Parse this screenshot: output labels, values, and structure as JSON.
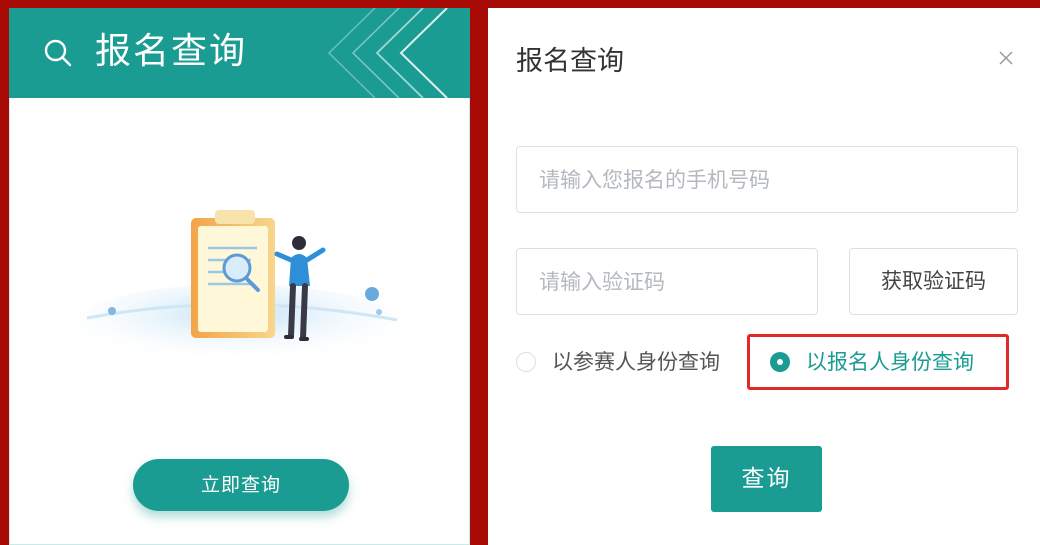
{
  "left_card": {
    "title": "报名查询",
    "button_label": "立即查询"
  },
  "dialog": {
    "title": "报名查询",
    "phone_placeholder": "请输入您报名的手机号码",
    "code_placeholder": "请输入验证码",
    "get_code_label": "获取验证码",
    "options": [
      {
        "label": "以参赛人身份查询",
        "selected": false
      },
      {
        "label": "以报名人身份查询",
        "selected": true
      }
    ],
    "query_label": "查询"
  },
  "colors": {
    "teal": "#1b9c93",
    "frame_red": "#a80b06",
    "highlight_red": "#e02a2a"
  },
  "icons": {
    "search": "search-icon",
    "close": "close-icon",
    "chevrons": "chevron-left-icon"
  }
}
